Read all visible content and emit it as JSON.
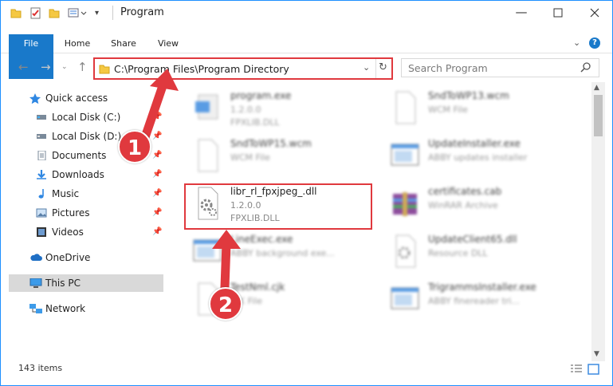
{
  "window": {
    "title": "Program"
  },
  "ribbon": {
    "tabs": [
      "File",
      "Home",
      "Share",
      "View"
    ]
  },
  "address": {
    "path": "C:\\Program Files\\Program Directory"
  },
  "search": {
    "placeholder": "Search Program"
  },
  "sidebar": {
    "items": [
      {
        "label": "Quick access",
        "icon": "star-icon"
      },
      {
        "label": "Local Disk (C:)",
        "icon": "drive-icon",
        "pinned": true
      },
      {
        "label": "Local Disk (D:)",
        "icon": "drive-icon",
        "pinned": true
      },
      {
        "label": "Documents",
        "icon": "documents-icon",
        "pinned": true
      },
      {
        "label": "Downloads",
        "icon": "downloads-icon",
        "pinned": true
      },
      {
        "label": "Music",
        "icon": "music-icon",
        "pinned": true
      },
      {
        "label": "Pictures",
        "icon": "pictures-icon",
        "pinned": true
      },
      {
        "label": "Videos",
        "icon": "videos-icon",
        "pinned": true
      },
      {
        "label": "OneDrive",
        "icon": "cloud-icon"
      },
      {
        "label": "This PC",
        "icon": "computer-icon",
        "selected": true
      },
      {
        "label": "Network",
        "icon": "network-icon"
      }
    ]
  },
  "files": [
    {
      "name": "program.exe",
      "line2": "1.2.0.0",
      "line3": "FPXLIB.DLL",
      "icon": "exe-icon"
    },
    {
      "name": "SndToWP13.wcm",
      "line2": "WCM File",
      "line3": "",
      "icon": "blank-file-icon"
    },
    {
      "name": "SndToWP15.wcm",
      "line2": "WCM File",
      "line3": "",
      "icon": "blank-file-icon"
    },
    {
      "name": "UpdateInstaller.exe",
      "line2": "ABBY updates installer",
      "line3": "",
      "icon": "app-window-icon"
    },
    {
      "name": "libr_rl_fpxjpeg_.dll",
      "line2": "1.2.0.0",
      "line3": "FPXLIB.DLL",
      "icon": "dll-gear-icon"
    },
    {
      "name": "certificates.cab",
      "line2": "WinRAR Archive",
      "line3": "",
      "icon": "archive-icon"
    },
    {
      "name": "LineExec.exe",
      "line2": "ABBY background exe...",
      "line3": "",
      "icon": "app-window-icon"
    },
    {
      "name": "UpdateClient65.dll",
      "line2": "Resource DLL",
      "line3": "",
      "icon": "dll-gear-icon"
    },
    {
      "name": "TestNml.cjk",
      "line2": "CJK File",
      "line3": "",
      "icon": "blank-file-icon"
    },
    {
      "name": "TrigrammsInstaller.exe",
      "line2": "ABBY finereader tri...",
      "line3": "",
      "icon": "app-window-icon"
    }
  ],
  "status": {
    "count": "143 items"
  },
  "annotations": {
    "step1": "1",
    "step2": "2"
  },
  "colors": {
    "accent": "#1979ca",
    "highlight": "#e0393e"
  }
}
